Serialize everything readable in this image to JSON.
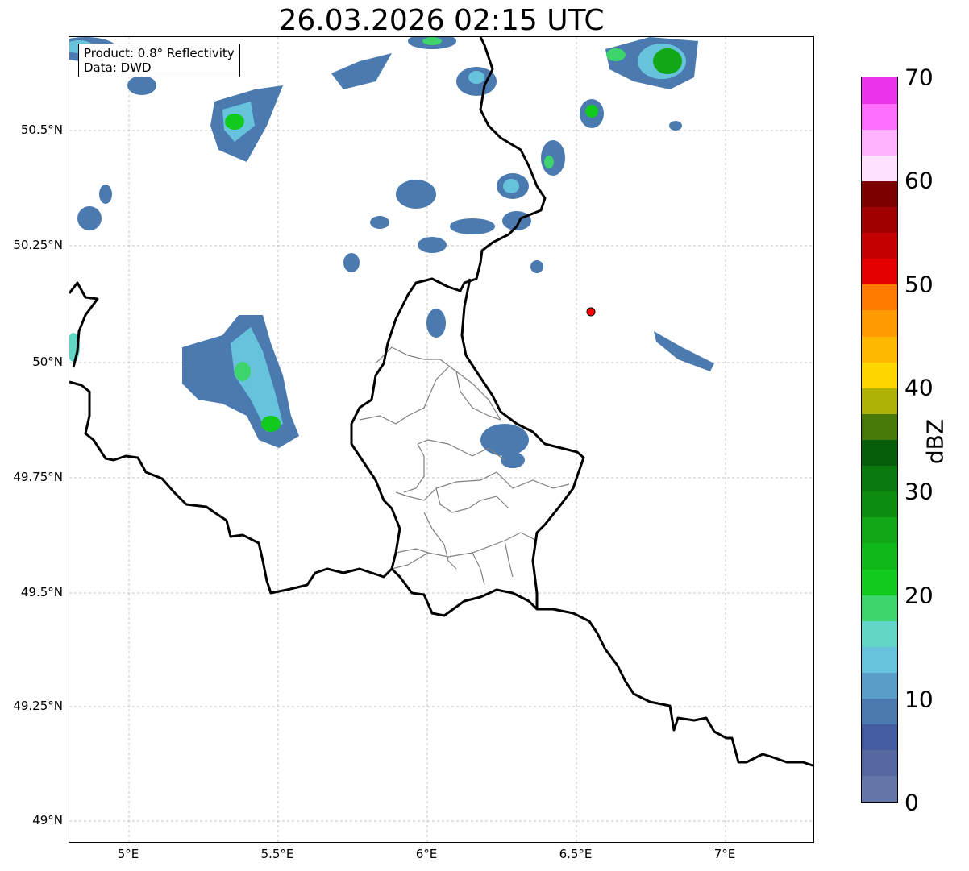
{
  "title": "26.03.2026 02:15 UTC",
  "info": {
    "product": "Product: 0.8° Reflectivity",
    "data": "Data: DWD"
  },
  "axes": {
    "lon_ticks": [
      "5°E",
      "5.5°E",
      "6°E",
      "6.5°E",
      "7°E"
    ],
    "lat_ticks": [
      "50.5°N",
      "50.25°N",
      "50°N",
      "49.75°N",
      "49.5°N",
      "49.25°N",
      "49°N"
    ]
  },
  "colorbar": {
    "label": "dBZ",
    "ticks": [
      "0",
      "10",
      "20",
      "30",
      "40",
      "50",
      "60",
      "70"
    ],
    "colors": [
      "#6476a8",
      "#54689f",
      "#435da0",
      "#4a7ab0",
      "#5a9dc8",
      "#67c3dc",
      "#61d6c5",
      "#3dd46c",
      "#12c91e",
      "#10b91a",
      "#12a716",
      "#0d8c10",
      "#0b7a0e",
      "#075e0a",
      "#477a09",
      "#afb105",
      "#ffd600",
      "#ffb800",
      "#ff9a00",
      "#ff7b00",
      "#e50000",
      "#c40000",
      "#a00000",
      "#7c0000",
      "#ffe0ff",
      "#ffb2ff",
      "#ff6eff",
      "#ea33ea"
    ]
  },
  "site_marker": {
    "color": "#ff0000",
    "description": "radar site"
  },
  "colors": {
    "border": "#000000",
    "inner_border": "#808080",
    "grid": "#b0b0b0"
  }
}
